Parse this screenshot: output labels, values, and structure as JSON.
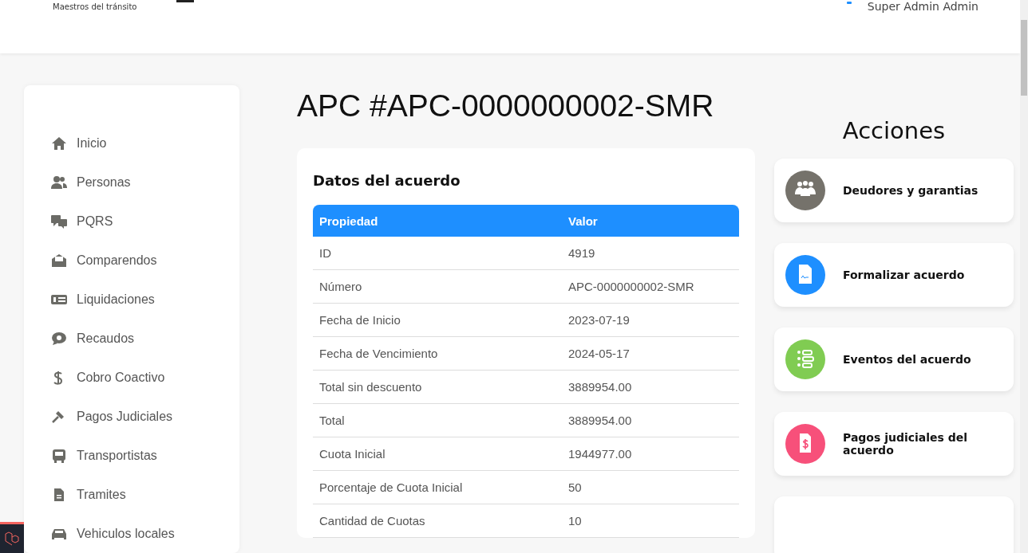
{
  "header": {
    "tagline": "Maestros del tránsito",
    "user": "Super Admin Admin"
  },
  "sidebar": {
    "items": [
      {
        "label": "Inicio",
        "kind": "home"
      },
      {
        "label": "Personas",
        "kind": "people"
      },
      {
        "label": "PQRS",
        "kind": "chat"
      },
      {
        "label": "Comparendos",
        "kind": "envelope"
      },
      {
        "label": "Liquidaciones",
        "kind": "bill"
      },
      {
        "label": "Recaudos",
        "kind": "coin"
      },
      {
        "label": "Cobro Coactivo",
        "kind": "dollar"
      },
      {
        "label": "Pagos Judiciales",
        "kind": "gavel"
      },
      {
        "label": "Transportistas",
        "kind": "bus"
      },
      {
        "label": "Tramites",
        "kind": "file"
      },
      {
        "label": "Vehiculos locales",
        "kind": "car"
      }
    ]
  },
  "page_title": "APC #APC-0000000002-SMR",
  "agreement": {
    "title": "Datos del acuerdo",
    "columns": [
      "Propiedad",
      "Valor"
    ],
    "rows": [
      [
        "ID",
        "4919"
      ],
      [
        "Número",
        "APC-0000000002-SMR"
      ],
      [
        "Fecha de Inicio",
        "2023-07-19"
      ],
      [
        "Fecha de Vencimiento",
        "2024-05-17"
      ],
      [
        "Total sin descuento",
        "3889954.00"
      ],
      [
        "Total",
        "3889954.00"
      ],
      [
        "Cuota Inicial",
        "1944977.00"
      ],
      [
        "Porcentaje de Cuota Inicial",
        "50"
      ],
      [
        "Cantidad de Cuotas",
        "10"
      ]
    ]
  },
  "actions": {
    "title": "Acciones",
    "items": [
      {
        "label": "Deudores y garantias",
        "kind": "group",
        "color": "#75726b"
      },
      {
        "label": "Formalizar acuerdo",
        "kind": "document",
        "color": "#1e8fff"
      },
      {
        "label": "Eventos del acuerdo",
        "kind": "list",
        "color": "#80cc52"
      },
      {
        "label": "Pagos judiciales del acuerdo",
        "kind": "receipt",
        "color": "#f7507a"
      }
    ]
  }
}
